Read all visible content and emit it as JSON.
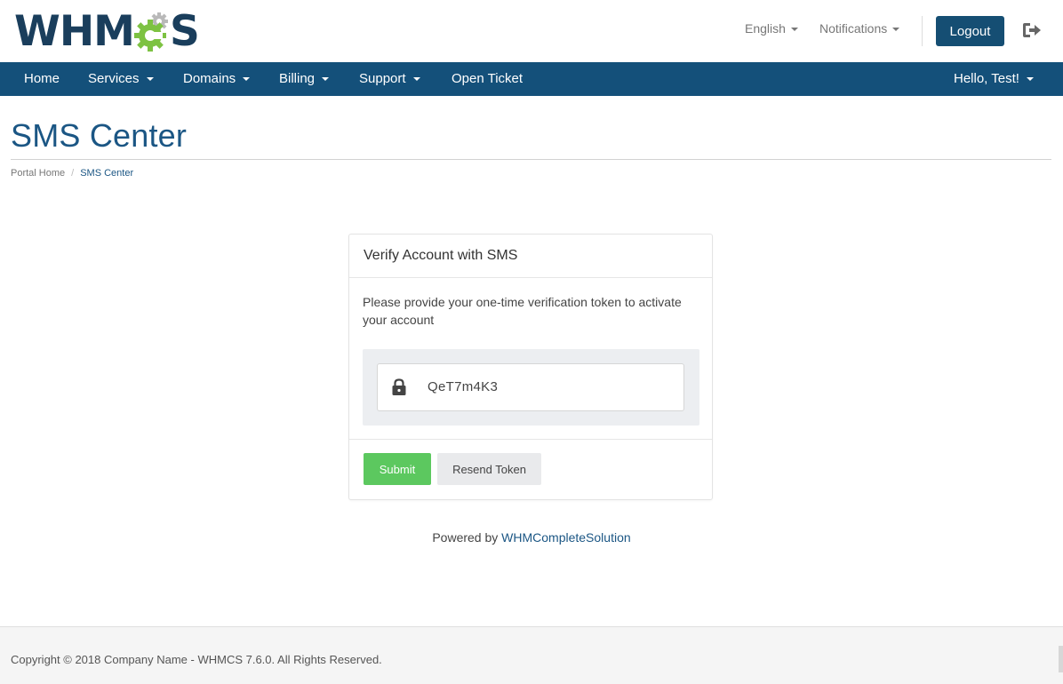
{
  "header": {
    "logo_prefix": "WHM",
    "logo_suffix": "S",
    "language": "English",
    "notifications": "Notifications",
    "logout": "Logout",
    "exit_icon": "sign-out-icon"
  },
  "nav": {
    "items": [
      {
        "label": "Home",
        "dropdown": false
      },
      {
        "label": "Services",
        "dropdown": true
      },
      {
        "label": "Domains",
        "dropdown": true
      },
      {
        "label": "Billing",
        "dropdown": true
      },
      {
        "label": "Support",
        "dropdown": true
      },
      {
        "label": "Open Ticket",
        "dropdown": false
      }
    ],
    "account": "Hello, Test!"
  },
  "page": {
    "title": "SMS Center",
    "breadcrumb": [
      "Portal Home",
      "SMS Center"
    ]
  },
  "card": {
    "title": "Verify Account with SMS",
    "description": "Please provide your one-time verification token to activate your account",
    "token_value": "QeT7m4K3",
    "token_icon": "lock-icon",
    "submit": "Submit",
    "resend": "Resend Token"
  },
  "powered": {
    "prefix": "Powered by",
    "link": "WHMCompleteSolution"
  },
  "footer": {
    "copyright": "Copyright © 2018 Company Name - WHMCS 7.6.0. All Rights Reserved."
  },
  "colors": {
    "brand": "#14507a",
    "title": "#1b5684",
    "submit": "#5cc85f",
    "gear_green": "#7dc242",
    "gear_gray": "#b9b9b9"
  }
}
